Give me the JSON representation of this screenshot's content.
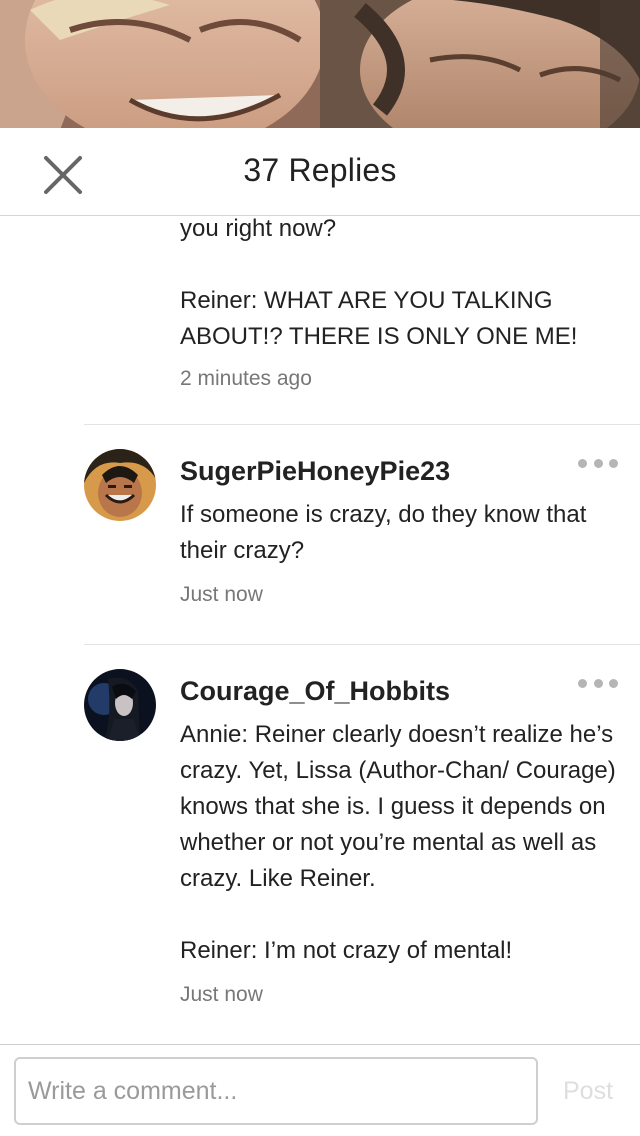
{
  "header": {
    "title": "37 Replies",
    "close_icon": "close-icon"
  },
  "previous_comment": {
    "body": "you right now?\n\nReiner: WHAT ARE YOU TALKING ABOUT!? THERE IS ONLY ONE ME!",
    "time": "2 minutes ago"
  },
  "comments": [
    {
      "username": "SugerPieHoneyPie23",
      "body": "If someone is crazy, do they know that their crazy?",
      "time": "Just now",
      "more_icon": "more-options-icon"
    },
    {
      "username": "Courage_Of_Hobbits",
      "body": "Annie: Reiner clearly doesn’t realize he’s crazy. Yet, Lissa (Author-Chan/ Courage) knows that she is. I guess it depends on whether or not you’re mental as well as crazy. Like Reiner.\n\nReiner: I’m not crazy of mental!",
      "time": "Just now",
      "more_icon": "more-options-icon"
    }
  ],
  "composer": {
    "placeholder": "Write a comment...",
    "post_label": "Post",
    "post_color": "#dedede"
  }
}
